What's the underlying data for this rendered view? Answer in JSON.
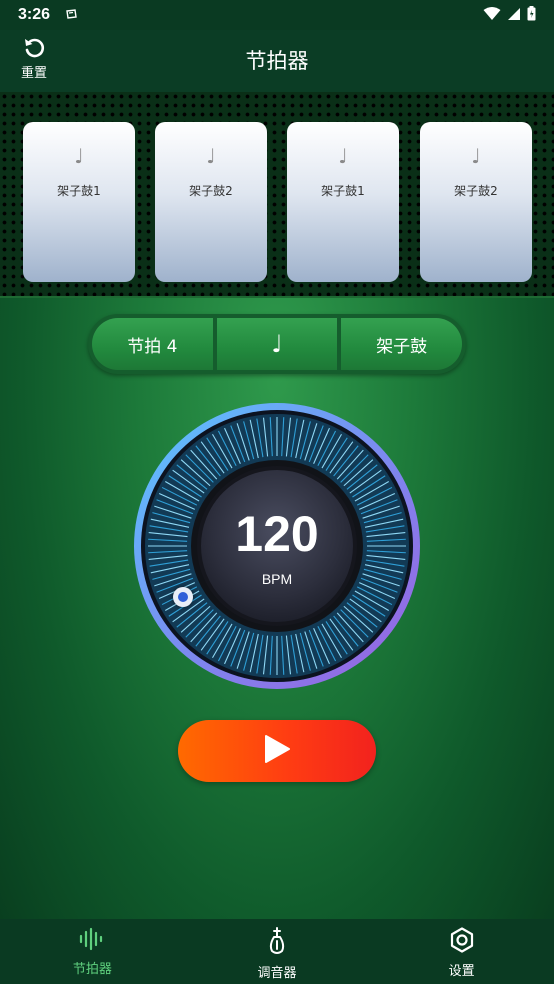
{
  "status_bar": {
    "time": "3:26"
  },
  "header": {
    "reset_label": "重置",
    "title": "节拍器"
  },
  "beats": [
    {
      "note": "♩",
      "label": "架子鼓1"
    },
    {
      "note": "♩",
      "label": "架子鼓2"
    },
    {
      "note": "♩",
      "label": "架子鼓1"
    },
    {
      "note": "♩",
      "label": "架子鼓2"
    }
  ],
  "controls": {
    "beat_label": "节拍 4",
    "note_symbol": "♩",
    "sound_label": "架子鼓"
  },
  "dial": {
    "bpm": "120",
    "unit": "BPM"
  },
  "bottom_nav": [
    {
      "label": "节拍器",
      "icon": "waveform-icon",
      "active": true
    },
    {
      "label": "调音器",
      "icon": "tuning-fork-icon",
      "active": false
    },
    {
      "label": "设置",
      "icon": "gear-icon",
      "active": false
    }
  ],
  "colors": {
    "accent_green": "#5fd07e",
    "play_orange": "#ff6a00",
    "play_red": "#f2221e",
    "dial_blue": "#3fb6e6"
  }
}
